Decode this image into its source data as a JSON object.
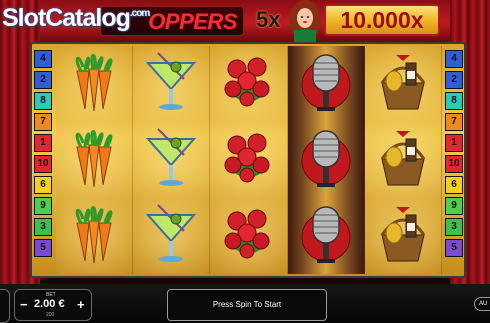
{
  "header": {
    "watermark_main": "SlotCatalog",
    "watermark_suffix": ".com",
    "title": "OPPERS",
    "multiplier_prefix": "5x",
    "max_multiplier": "10.000x"
  },
  "paylines": {
    "left": [
      "4",
      "2",
      "8",
      "7",
      "1",
      "10",
      "6",
      "9",
      "3",
      "5"
    ],
    "right": [
      "4",
      "2",
      "8",
      "7",
      "1",
      "10",
      "6",
      "9",
      "3",
      "5"
    ],
    "colors": {
      "1": "#e6262e",
      "2": "#2f5fd8",
      "3": "#3cc24a",
      "4": "#2f5fd8",
      "5": "#7a4ad6",
      "6": "#f2d21c",
      "7": "#f08a1e",
      "8": "#2ec9b8",
      "9": "#4fd04a",
      "10": "#e6262e"
    }
  },
  "reels": [
    [
      "carrot-icon",
      "martini-icon",
      "roses-icon",
      "microphone-icon",
      "gift-basket-icon"
    ],
    [
      "carrot-icon",
      "martini-icon",
      "roses-icon",
      "microphone-icon",
      "gift-basket-icon"
    ],
    [
      "carrot-icon",
      "martini-icon",
      "roses-icon",
      "microphone-icon",
      "gift-basket-icon"
    ]
  ],
  "controls": {
    "bet_label": "BET",
    "bet_value": "2.00 €",
    "bet_sub": "200",
    "minus": "−",
    "plus": "+",
    "spin_label": "Press Spin To Start",
    "auto_label": "AU"
  }
}
